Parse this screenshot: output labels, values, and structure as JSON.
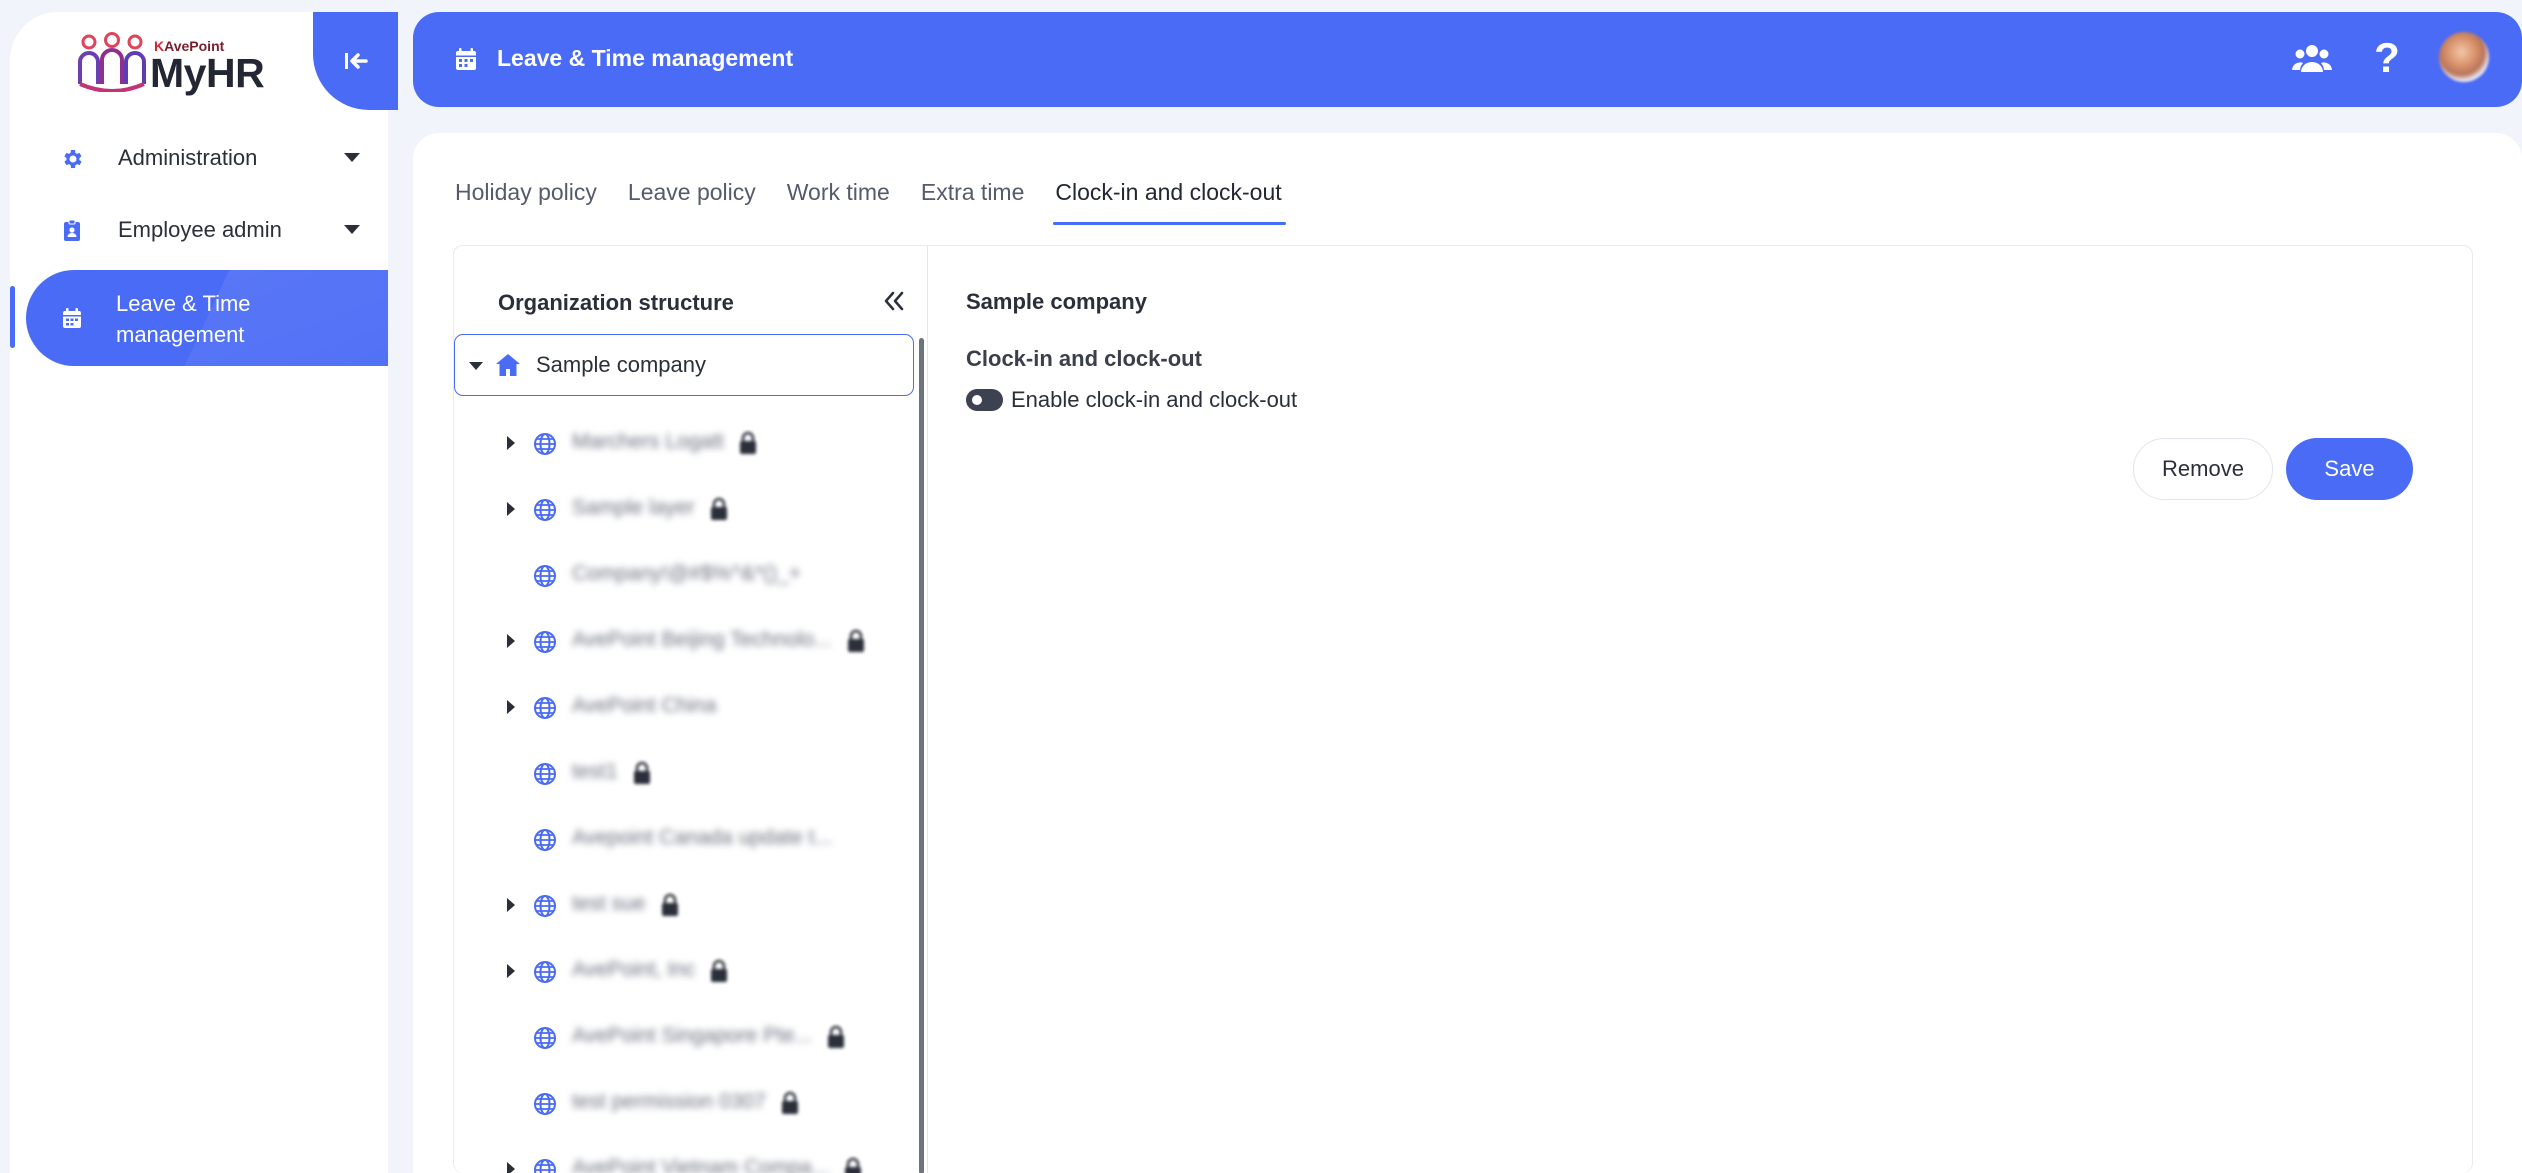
{
  "brand": {
    "vendor": "AvePoint",
    "product": "MyHR"
  },
  "sidebar": {
    "items": [
      {
        "label": "Administration",
        "icon": "gear-icon",
        "expandable": true
      },
      {
        "label": "Employee admin",
        "icon": "id-badge-icon",
        "expandable": true
      },
      {
        "label": "Leave & Time management",
        "icon": "calendar-icon",
        "active": true
      }
    ]
  },
  "header": {
    "title": "Leave & Time management",
    "icons": [
      "calendar-icon",
      "people-icon",
      "help-icon",
      "avatar"
    ],
    "help_glyph": "?"
  },
  "tabs": [
    {
      "label": "Holiday policy"
    },
    {
      "label": "Leave policy"
    },
    {
      "label": "Work time"
    },
    {
      "label": "Extra time"
    },
    {
      "label": "Clock-in and clock-out",
      "active": true
    }
  ],
  "tree": {
    "title": "Organization structure",
    "root": {
      "label": "Sample company",
      "expanded": true,
      "selected": true
    },
    "children": [
      {
        "label": "Marchers Logatt",
        "has_children": true,
        "locked": true
      },
      {
        "label": "Sample layer",
        "has_children": true,
        "locked": true
      },
      {
        "label": "Company!@#$%^&*()_+",
        "has_children": false,
        "locked": false
      },
      {
        "label": "AvePoint Beijing Technolo...",
        "has_children": true,
        "locked": true
      },
      {
        "label": "AvePoint China",
        "has_children": true,
        "locked": false
      },
      {
        "label": "test1",
        "has_children": false,
        "locked": true
      },
      {
        "label": "Avepoint Canada update t...",
        "has_children": false,
        "locked": false
      },
      {
        "label": "test sue",
        "has_children": true,
        "locked": true
      },
      {
        "label": "AvePoint, Inc",
        "has_children": true,
        "locked": true
      },
      {
        "label": "AvePoint Singapore Pte...",
        "has_children": false,
        "locked": true
      },
      {
        "label": "test permission 0307",
        "has_children": false,
        "locked": true
      },
      {
        "label": "AvePoint Vietnam Compa...",
        "has_children": true,
        "locked": true
      }
    ]
  },
  "detail": {
    "company": "Sample company",
    "section_title": "Clock-in and clock-out",
    "toggle_label": "Enable clock-in and clock-out",
    "toggle_on": false,
    "remove_label": "Remove",
    "save_label": "Save"
  },
  "colors": {
    "accent": "#4a6bf5",
    "background": "#f2f4fb",
    "text": "#2a2f3a"
  }
}
